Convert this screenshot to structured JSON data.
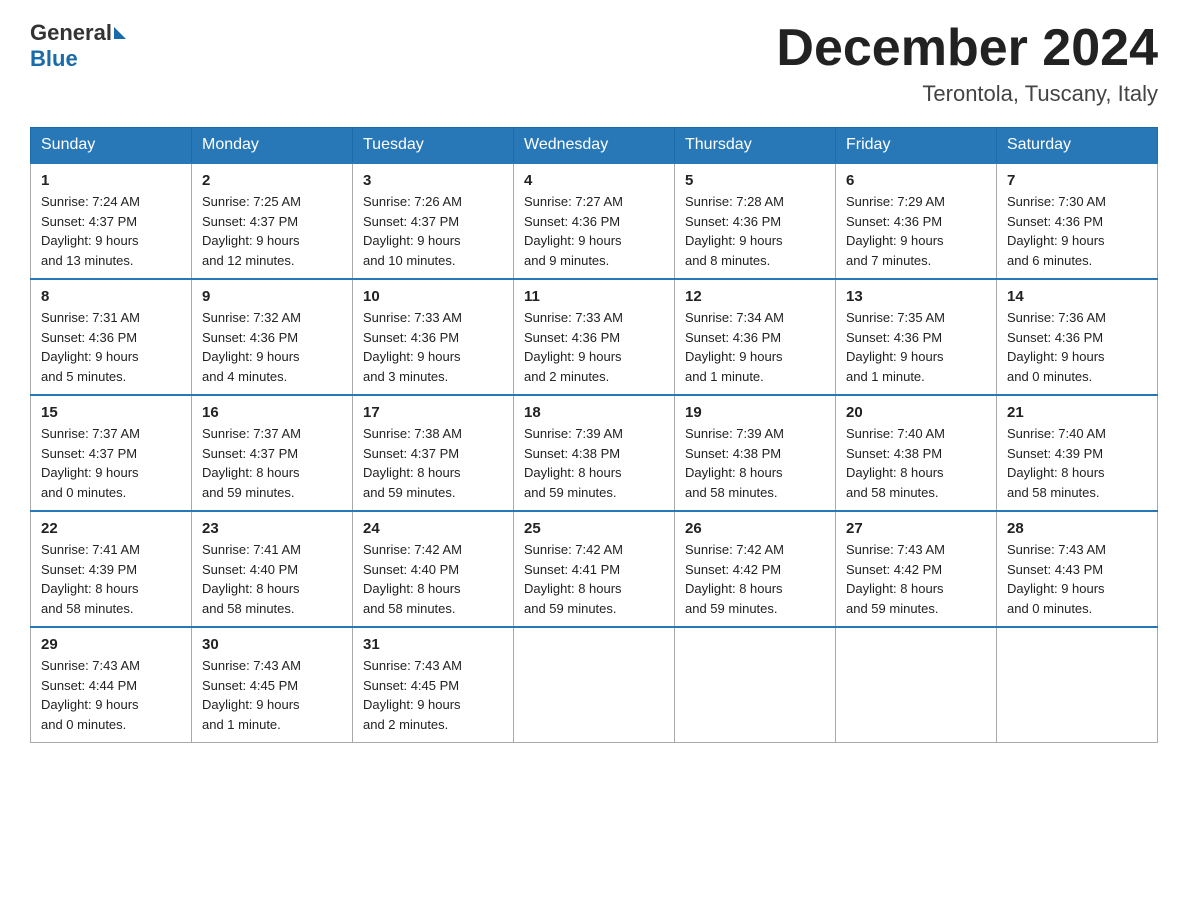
{
  "header": {
    "logo_general": "General",
    "logo_blue": "Blue",
    "month_title": "December 2024",
    "location": "Terontola, Tuscany, Italy"
  },
  "weekdays": [
    "Sunday",
    "Monday",
    "Tuesday",
    "Wednesday",
    "Thursday",
    "Friday",
    "Saturday"
  ],
  "weeks": [
    [
      {
        "day": "1",
        "sunrise": "7:24 AM",
        "sunset": "4:37 PM",
        "daylight": "9 hours and 13 minutes."
      },
      {
        "day": "2",
        "sunrise": "7:25 AM",
        "sunset": "4:37 PM",
        "daylight": "9 hours and 12 minutes."
      },
      {
        "day": "3",
        "sunrise": "7:26 AM",
        "sunset": "4:37 PM",
        "daylight": "9 hours and 10 minutes."
      },
      {
        "day": "4",
        "sunrise": "7:27 AM",
        "sunset": "4:36 PM",
        "daylight": "9 hours and 9 minutes."
      },
      {
        "day": "5",
        "sunrise": "7:28 AM",
        "sunset": "4:36 PM",
        "daylight": "9 hours and 8 minutes."
      },
      {
        "day": "6",
        "sunrise": "7:29 AM",
        "sunset": "4:36 PM",
        "daylight": "9 hours and 7 minutes."
      },
      {
        "day": "7",
        "sunrise": "7:30 AM",
        "sunset": "4:36 PM",
        "daylight": "9 hours and 6 minutes."
      }
    ],
    [
      {
        "day": "8",
        "sunrise": "7:31 AM",
        "sunset": "4:36 PM",
        "daylight": "9 hours and 5 minutes."
      },
      {
        "day": "9",
        "sunrise": "7:32 AM",
        "sunset": "4:36 PM",
        "daylight": "9 hours and 4 minutes."
      },
      {
        "day": "10",
        "sunrise": "7:33 AM",
        "sunset": "4:36 PM",
        "daylight": "9 hours and 3 minutes."
      },
      {
        "day": "11",
        "sunrise": "7:33 AM",
        "sunset": "4:36 PM",
        "daylight": "9 hours and 2 minutes."
      },
      {
        "day": "12",
        "sunrise": "7:34 AM",
        "sunset": "4:36 PM",
        "daylight": "9 hours and 1 minute."
      },
      {
        "day": "13",
        "sunrise": "7:35 AM",
        "sunset": "4:36 PM",
        "daylight": "9 hours and 1 minute."
      },
      {
        "day": "14",
        "sunrise": "7:36 AM",
        "sunset": "4:36 PM",
        "daylight": "9 hours and 0 minutes."
      }
    ],
    [
      {
        "day": "15",
        "sunrise": "7:37 AM",
        "sunset": "4:37 PM",
        "daylight": "9 hours and 0 minutes."
      },
      {
        "day": "16",
        "sunrise": "7:37 AM",
        "sunset": "4:37 PM",
        "daylight": "8 hours and 59 minutes."
      },
      {
        "day": "17",
        "sunrise": "7:38 AM",
        "sunset": "4:37 PM",
        "daylight": "8 hours and 59 minutes."
      },
      {
        "day": "18",
        "sunrise": "7:39 AM",
        "sunset": "4:38 PM",
        "daylight": "8 hours and 59 minutes."
      },
      {
        "day": "19",
        "sunrise": "7:39 AM",
        "sunset": "4:38 PM",
        "daylight": "8 hours and 58 minutes."
      },
      {
        "day": "20",
        "sunrise": "7:40 AM",
        "sunset": "4:38 PM",
        "daylight": "8 hours and 58 minutes."
      },
      {
        "day": "21",
        "sunrise": "7:40 AM",
        "sunset": "4:39 PM",
        "daylight": "8 hours and 58 minutes."
      }
    ],
    [
      {
        "day": "22",
        "sunrise": "7:41 AM",
        "sunset": "4:39 PM",
        "daylight": "8 hours and 58 minutes."
      },
      {
        "day": "23",
        "sunrise": "7:41 AM",
        "sunset": "4:40 PM",
        "daylight": "8 hours and 58 minutes."
      },
      {
        "day": "24",
        "sunrise": "7:42 AM",
        "sunset": "4:40 PM",
        "daylight": "8 hours and 58 minutes."
      },
      {
        "day": "25",
        "sunrise": "7:42 AM",
        "sunset": "4:41 PM",
        "daylight": "8 hours and 59 minutes."
      },
      {
        "day": "26",
        "sunrise": "7:42 AM",
        "sunset": "4:42 PM",
        "daylight": "8 hours and 59 minutes."
      },
      {
        "day": "27",
        "sunrise": "7:43 AM",
        "sunset": "4:42 PM",
        "daylight": "8 hours and 59 minutes."
      },
      {
        "day": "28",
        "sunrise": "7:43 AM",
        "sunset": "4:43 PM",
        "daylight": "9 hours and 0 minutes."
      }
    ],
    [
      {
        "day": "29",
        "sunrise": "7:43 AM",
        "sunset": "4:44 PM",
        "daylight": "9 hours and 0 minutes."
      },
      {
        "day": "30",
        "sunrise": "7:43 AM",
        "sunset": "4:45 PM",
        "daylight": "9 hours and 1 minute."
      },
      {
        "day": "31",
        "sunrise": "7:43 AM",
        "sunset": "4:45 PM",
        "daylight": "9 hours and 2 minutes."
      },
      null,
      null,
      null,
      null
    ]
  ],
  "labels": {
    "sunrise": "Sunrise:",
    "sunset": "Sunset:",
    "daylight": "Daylight:"
  }
}
